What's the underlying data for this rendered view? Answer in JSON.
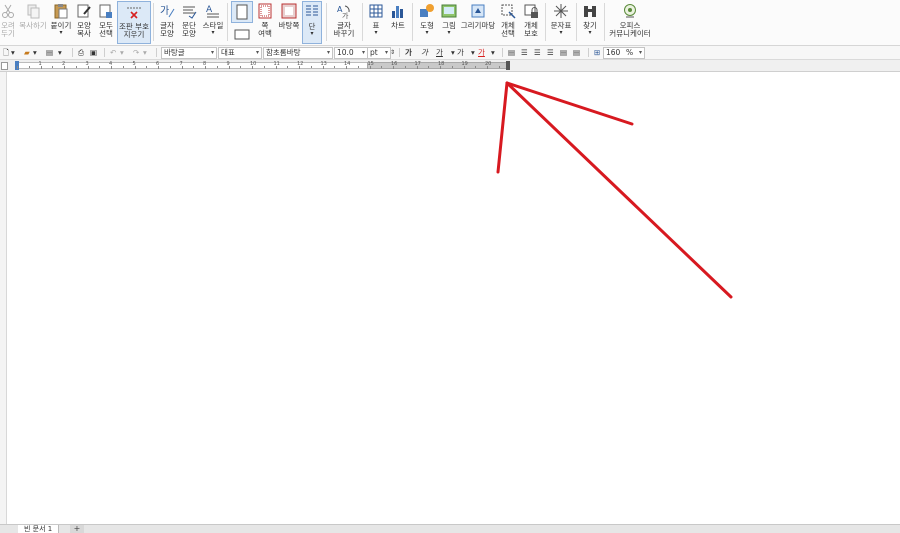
{
  "ribbon": {
    "cut": "오려\n두기",
    "copy": "복사하기",
    "paste": "붙이기",
    "format_copy": "모양\n복사",
    "select_all": "모두\n선택",
    "edit_restrict": "조판 부호\n지우기",
    "char_shape": "글자\n모양",
    "para_shape": "문단\n모양",
    "style": "스타일",
    "page_margin": "쪽\n여백",
    "page_bg": "바탕쪽",
    "column": "단",
    "change_case": "글자\n바꾸기",
    "table": "표",
    "chart": "차트",
    "shape": "도형",
    "picture": "그림",
    "drawing_market": "그리기마당",
    "select_obj": "개체\n선택",
    "protect_obj": "개체\n보호",
    "symbol": "문자표",
    "find": "찾기",
    "office_community": "오피스\n커뮤니케이터"
  },
  "toolbar": {
    "style_combo": "바탕글",
    "font_type_combo": "대표",
    "font_combo": "함초롬바탕",
    "size": "10.0",
    "unit": "pt",
    "zoom": "160",
    "zoom_unit": "%"
  },
  "ruler_numbers": [
    "1",
    "2",
    "3",
    "4",
    "5",
    "6",
    "7",
    "8",
    "9",
    "10",
    "11",
    "12",
    "13",
    "14",
    "15",
    "16",
    "17",
    "18",
    "19",
    "20"
  ],
  "tabs": {
    "doc_tab": "빈 문서 1",
    "add_tab": "+"
  },
  "colors": {
    "accent": "#dce9f7",
    "arrow": "#d71920"
  }
}
